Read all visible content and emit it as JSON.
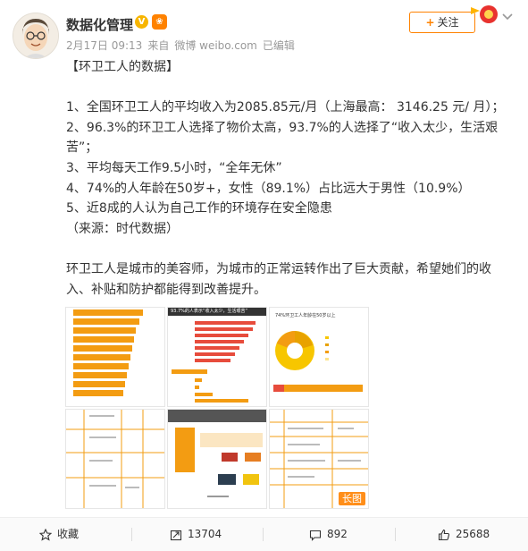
{
  "post": {
    "author": "数据化管理",
    "date": "2月17日 09:13",
    "source_prefix": "来自",
    "source": "微博 weibo.com",
    "edited": "已编辑",
    "follow_label": "关注",
    "lines": [
      "【环卫工人的数据】",
      "",
      "1、全国环卫工人的平均收入为2085.85元/月（上海最高： 3146.25 元/ 月）；",
      "2、96.3%的环卫工人选择了物价太高，93.7%的人选择了“收入太少，生活艰苦”；",
      "3、平均每天工作9.5小时，“全年无休”",
      "4、74%的人年龄在50岁+，女性（89.1%）占比远大于男性（10.9%）",
      "5、近8成的人认为自己工作的环境存在安全隐患",
      "（来源：时代数据）",
      "",
      "环卫工人是城市的美容师，为城市的正常运转作出了巨大贡献，希望她们的收入、补贴和防护都能得到改善提升。"
    ]
  },
  "images": {
    "thumb2_title": "93.7%的人表示“收入太少，生活艰苦”",
    "thumb3_title": "74%环卫工人年龄在50岁以上",
    "long_image_tag": "长图"
  },
  "footer": {
    "collect_label": "收藏",
    "repost_count": "13704",
    "comment_count": "892",
    "like_count": "25688"
  },
  "colors": {
    "accent": "#ff8200",
    "chart_orange": "#f39c12",
    "chart_red": "#e74c3c",
    "chart_yellow": "#f7c600"
  }
}
